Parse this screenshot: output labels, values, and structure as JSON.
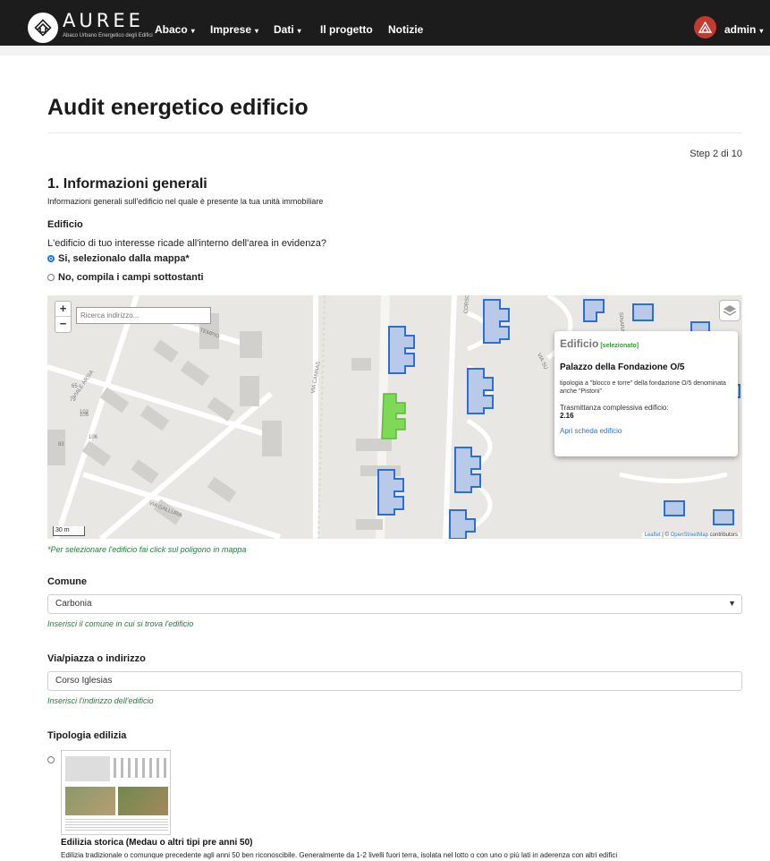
{
  "navbar": {
    "logo_text": "AUREE",
    "logo_subtitle": "Abaco Urbano Energetico degli Edifici",
    "items": [
      {
        "label": "Abaco",
        "dropdown": true
      },
      {
        "label": "Imprese",
        "dropdown": true
      },
      {
        "label": "Dati",
        "dropdown": true
      },
      {
        "label": "Il progetto",
        "dropdown": false
      },
      {
        "label": "Notizie",
        "dropdown": false
      }
    ],
    "user": "admin"
  },
  "page": {
    "title": "Audit energetico edificio",
    "step": "Step 2 di 10"
  },
  "section": {
    "title": "1. Informazioni generali",
    "description": "Informazioni generali sull'edificio nel quale è presente la tua unità immobiliare"
  },
  "edificio": {
    "label": "Edificio",
    "question": "L'edificio di tuo interesse ricade all'interno dell'area in evidenza?",
    "options": [
      {
        "label": "Si, selezionalo dalla mappa*",
        "checked": true
      },
      {
        "label": "No, compila i campi sottostanti",
        "checked": false
      }
    ]
  },
  "map": {
    "zoom_in": "+",
    "zoom_out": "−",
    "search_placeholder": "Ricerca indirizzo...",
    "scale": "30 m",
    "attribution_leaflet": "Leaflet",
    "attribution_sep": " | © ",
    "attribution_osm": "OpenStreetMap",
    "attribution_suffix": " contributors",
    "street_labels": [
      "VIALE ARSIA",
      "VIA CANNAS",
      "VIA GALLURA",
      "CORSO IGLE",
      "VIA SU",
      "SINARA",
      "TEMPIO",
      "105",
      "102",
      "106",
      "79",
      "83",
      "65"
    ],
    "popup": {
      "heading": "Edificio",
      "selected": "[selezionato]",
      "name": "Palazzo della Fondazione O/5",
      "description": "tipologia a \"blocco e torre\" della fondazione O/5 denominata anche \"Pistoni\"",
      "trasmittanza_label": "Trasmittanza complessiva edificio:",
      "trasmittanza_value": "2.16",
      "link": "Apri scheda edificio"
    },
    "help": "*Per selezionare l'edificio fai click sul poligono in mappa"
  },
  "comune": {
    "label": "Comune",
    "value": "Carbonia",
    "help": "Inserisci il comune in cui si trova l'edificio"
  },
  "indirizzo": {
    "label": "Via/piazza o indirizzo",
    "value": "Corso Iglesias",
    "help": "Inserisci l'indirizzo dell'edificio"
  },
  "tipologia": {
    "label": "Tipologia edilizia",
    "option_title": "Edilizia storica (Medau o altri tipi pre anni 50)",
    "option_desc": "Edilizia tradizionale o comunque precedente agli anni 50 ben riconoscibile. Generalmente da 1-2 livelli fuori terra, isolata nel lotto o con uno o più lati in aderenza con altri edifici"
  },
  "colors": {
    "navbar": "#1c1c1c",
    "building_fill": "#b9c9e8",
    "building_stroke": "#2b6fd6",
    "selected_fill": "#7ed957",
    "help_text": "#257a3e",
    "link": "#2a74c8"
  }
}
